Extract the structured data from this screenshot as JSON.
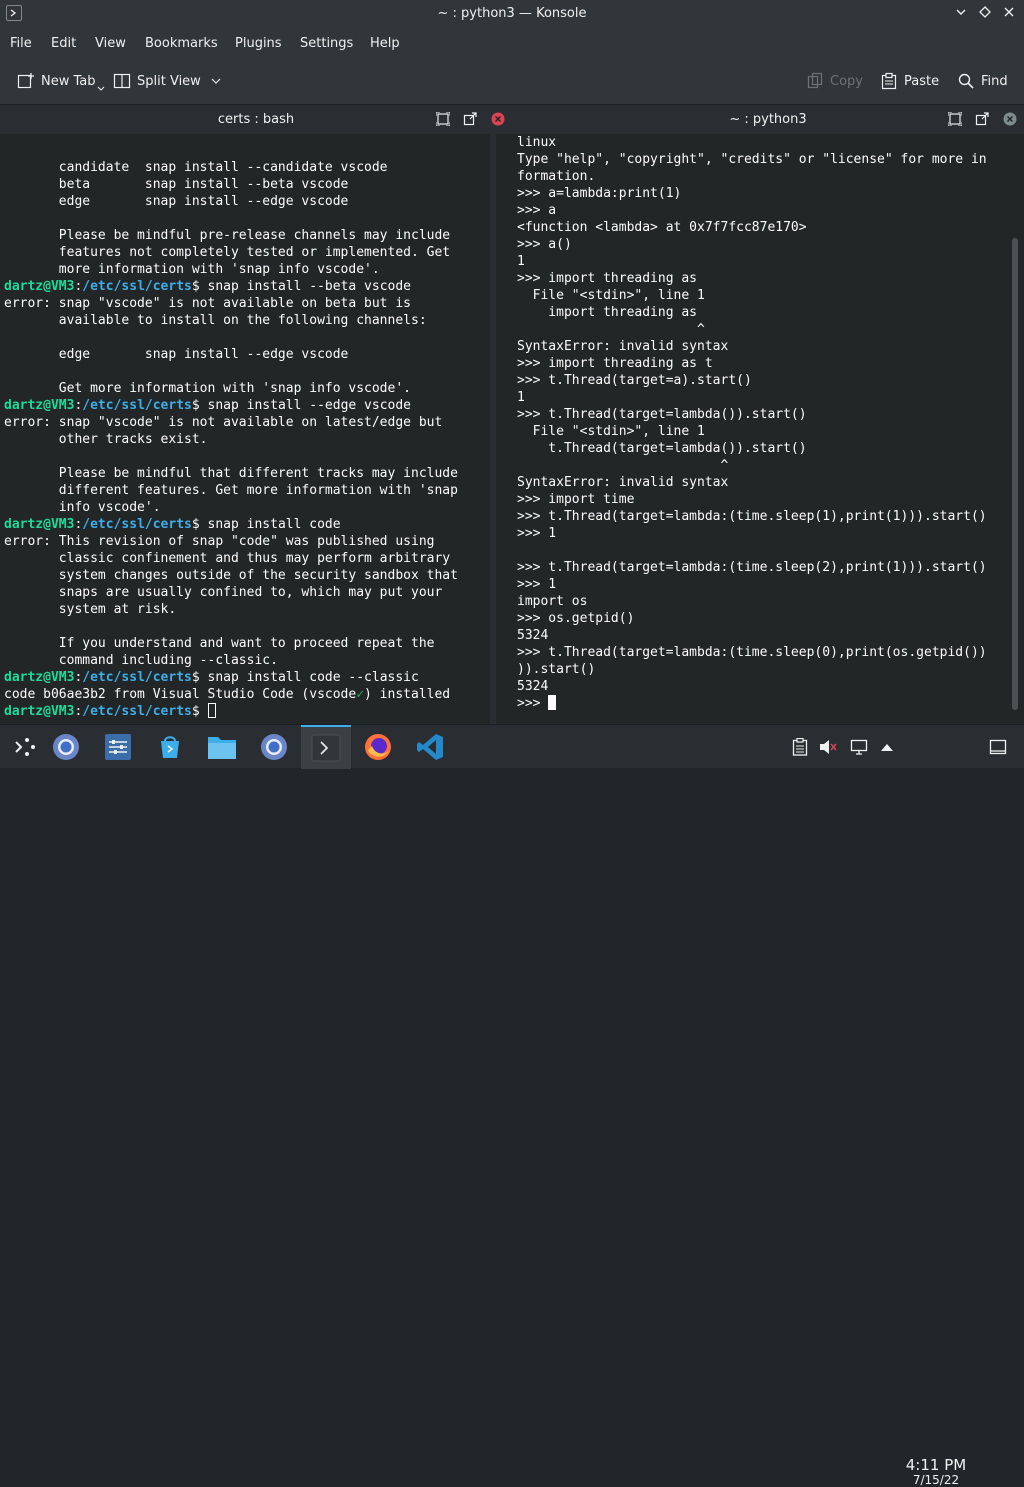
{
  "window": {
    "title": "~ : python3 — Konsole"
  },
  "menu": [
    "File",
    "Edit",
    "View",
    "Bookmarks",
    "Plugins",
    "Settings",
    "Help"
  ],
  "toolbar": {
    "new_tab": "New Tab",
    "split_view": "Split View",
    "copy": "Copy",
    "paste": "Paste",
    "find": "Find"
  },
  "left_pane": {
    "title": "certs : bash"
  },
  "right_pane": {
    "title": "~ : python3"
  },
  "bash": {
    "user": "dartz@VM3",
    "path": "/etc/ssl/certs",
    "lines": [
      "",
      "       candidate  snap install --candidate vscode",
      "       beta       snap install --beta vscode",
      "       edge       snap install --edge vscode",
      "",
      "       Please be mindful pre-release channels may include",
      "       features not completely tested or implemented. Get",
      "       more information with 'snap info vscode'.",
      "cmd:snap install --beta vscode",
      "error: snap \"vscode\" is not available on beta but is",
      "       available to install on the following channels:",
      "",
      "       edge       snap install --edge vscode",
      "",
      "       Get more information with 'snap info vscode'.",
      "cmd:snap install --edge vscode",
      "error: snap \"vscode\" is not available on latest/edge but",
      "       other tracks exist.",
      "",
      "       Please be mindful that different tracks may include",
      "       different features. Get more information with 'snap",
      "       info vscode'.",
      "cmd:snap install code",
      "error: This revision of snap \"code\" was published using",
      "       classic confinement and thus may perform arbitrary",
      "       system changes outside of the security sandbox that",
      "       snaps are usually confined to, which may put your",
      "       system at risk.",
      "",
      "       If you understand and want to proceed repeat the",
      "       command including --classic.",
      "cmd:snap install code --classic",
      "installed:code b06ae3b2 from Visual Studio Code (vscode|✓|) installed",
      "cmd:"
    ]
  },
  "python": {
    "lines": [
      "linux",
      "Type \"help\", \"copyright\", \"credits\" or \"license\" for more in",
      "formation.",
      ">>> a=lambda:print(1)",
      ">>> a",
      "<function <lambda> at 0x7f7fcc87e170>",
      ">>> a()",
      "1",
      ">>> import threading as",
      "  File \"<stdin>\", line 1",
      "    import threading as",
      "                       ^",
      "SyntaxError: invalid syntax",
      ">>> import threading as t",
      ">>> t.Thread(target=a).start()",
      "1",
      ">>> t.Thread(target=lambda()).start()",
      "  File \"<stdin>\", line 1",
      "    t.Thread(target=lambda()).start()",
      "                          ^",
      "SyntaxError: invalid syntax",
      ">>> import time",
      ">>> t.Thread(target=lambda:(time.sleep(1),print(1))).start()",
      ">>> 1",
      "",
      ">>> t.Thread(target=lambda:(time.sleep(2),print(1))).start()",
      ">>> 1",
      "import os",
      ">>> os.getpid()",
      "5324",
      ">>> t.Thread(target=lambda:(time.sleep(0),print(os.getpid())",
      ")).start()",
      "5324",
      ">>> "
    ]
  },
  "taskbar": {
    "apps": [
      "launcher-icon",
      "chromium-icon",
      "settings-icon",
      "discover-icon",
      "files-icon",
      "chromium-icon",
      "konsole-icon",
      "firefox-icon",
      "vscode-icon"
    ]
  },
  "clock": {
    "time": "4:11 PM",
    "date": "7/15/22"
  },
  "colors": {
    "prompt_user": "#1cdc9a",
    "prompt_path": "#3daee9",
    "accent": "#3daee9",
    "background": "#232627"
  }
}
